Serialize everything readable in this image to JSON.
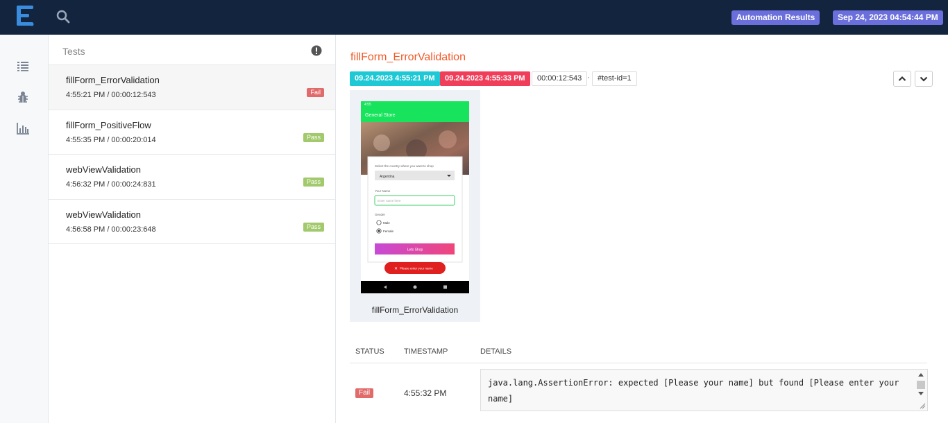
{
  "header": {
    "results_label": "Automation Results",
    "datetime": "Sep 24, 2023 04:54:44 PM"
  },
  "nav": [
    "list-icon",
    "bug-icon",
    "bar-chart-icon"
  ],
  "tests_panel": {
    "title": "Tests",
    "items": [
      {
        "name": "fillForm_ErrorValidation",
        "meta": "4:55:21 PM / 00:00:12:543",
        "status": "Fail"
      },
      {
        "name": "fillForm_PositiveFlow",
        "meta": "4:55:35 PM / 00:00:20:014",
        "status": "Pass"
      },
      {
        "name": "webViewValidation",
        "meta": "4:56:32 PM / 00:00:24:831",
        "status": "Pass"
      },
      {
        "name": "webViewValidation",
        "meta": "4:56:58 PM / 00:00:23:648",
        "status": "Pass"
      }
    ]
  },
  "detail": {
    "title": "fillForm_ErrorValidation",
    "start": "09.24.2023 4:55:21 PM",
    "end": "09.24.2023 4:55:33 PM",
    "duration": "00:00:12:543",
    "separator": "·",
    "test_id": "#test-id=1",
    "screenshot": {
      "caption": "fillForm_ErrorValidation",
      "status_time": "4:55",
      "app_title": "General Store",
      "country_prompt": "Select the country where you want to shop",
      "country_value": "Argentina",
      "name_label": "Your Name",
      "name_placeholder": "Enter name here",
      "gender_label": "Gender",
      "male": "Male",
      "female": "Female",
      "shop_button": "Lets Shop",
      "toast": "Please enter your name"
    },
    "table": {
      "headers": [
        "STATUS",
        "TIMESTAMP",
        "DETAILS"
      ],
      "row": {
        "status": "Fail",
        "timestamp": "4:55:32 PM",
        "details": "java.lang.AssertionError: expected [Please your name] but found [Please enter your name]"
      }
    }
  },
  "colors": {
    "topbar": "#13243f",
    "badge": "#6b6fdc",
    "title": "#f05a28",
    "start_chip": "#1ec8d4",
    "end_chip": "#f03e5a",
    "fail": "#e16b6b",
    "pass": "#a2c96b"
  }
}
